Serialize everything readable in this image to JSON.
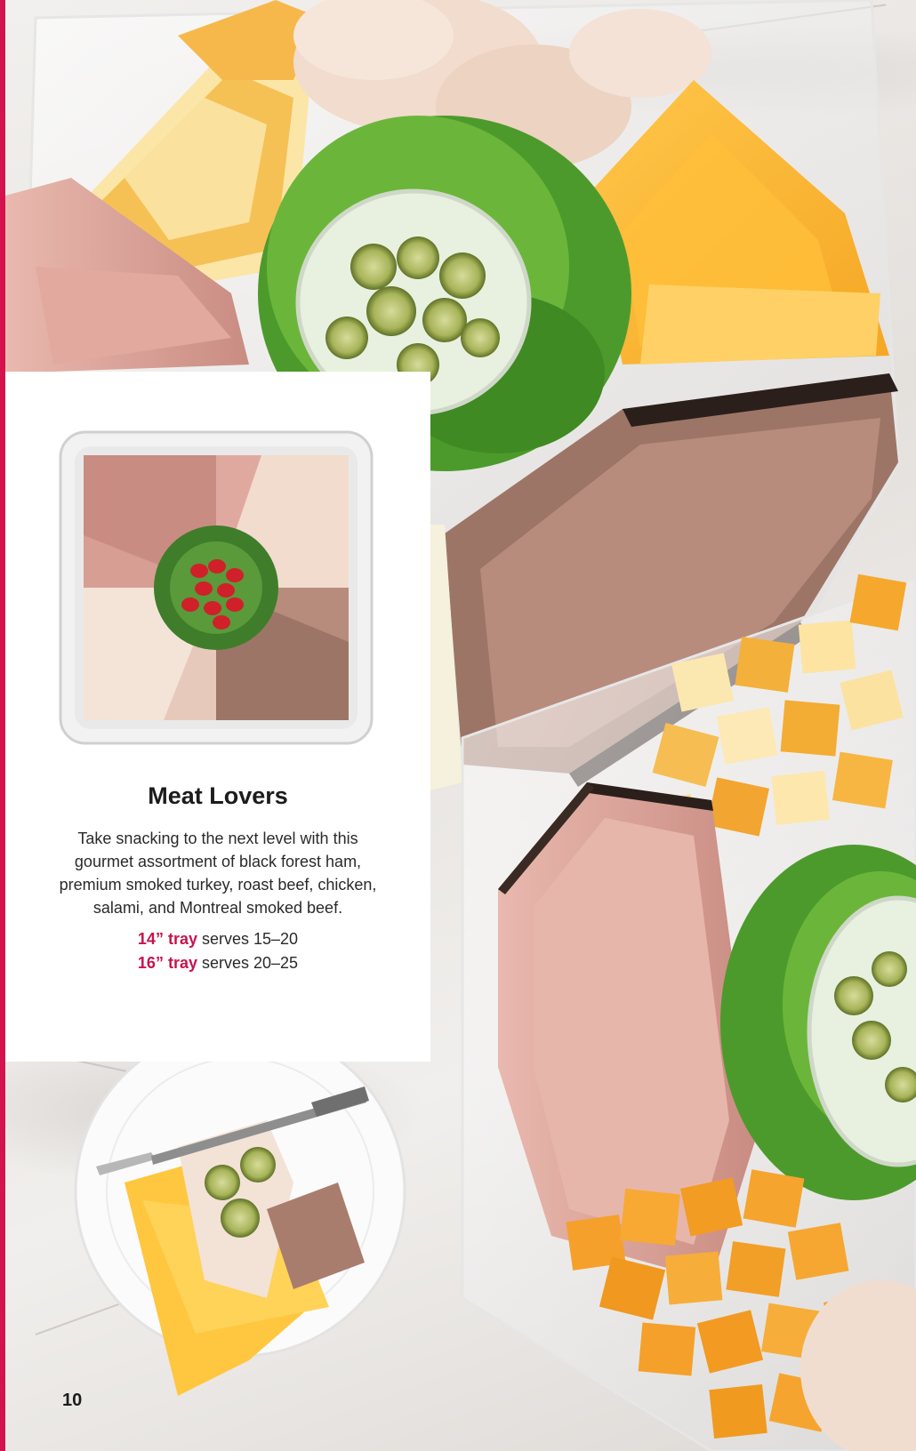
{
  "product": {
    "title": "Meat Lovers",
    "description": "Take snacking to the next level with this gourmet assortment of black forest ham, premium smoked turkey, roast beef, chicken, salami, and Montreal smoked beef.",
    "sizes": [
      {
        "label": "14” tray",
        "serves": "serves 15–20"
      },
      {
        "label": "16” tray",
        "serves": "serves 20–25"
      }
    ]
  },
  "page_number": "10",
  "colors": {
    "accent": "#d2134d",
    "highlight": "#c8134b",
    "text": "#1c1c1c"
  }
}
